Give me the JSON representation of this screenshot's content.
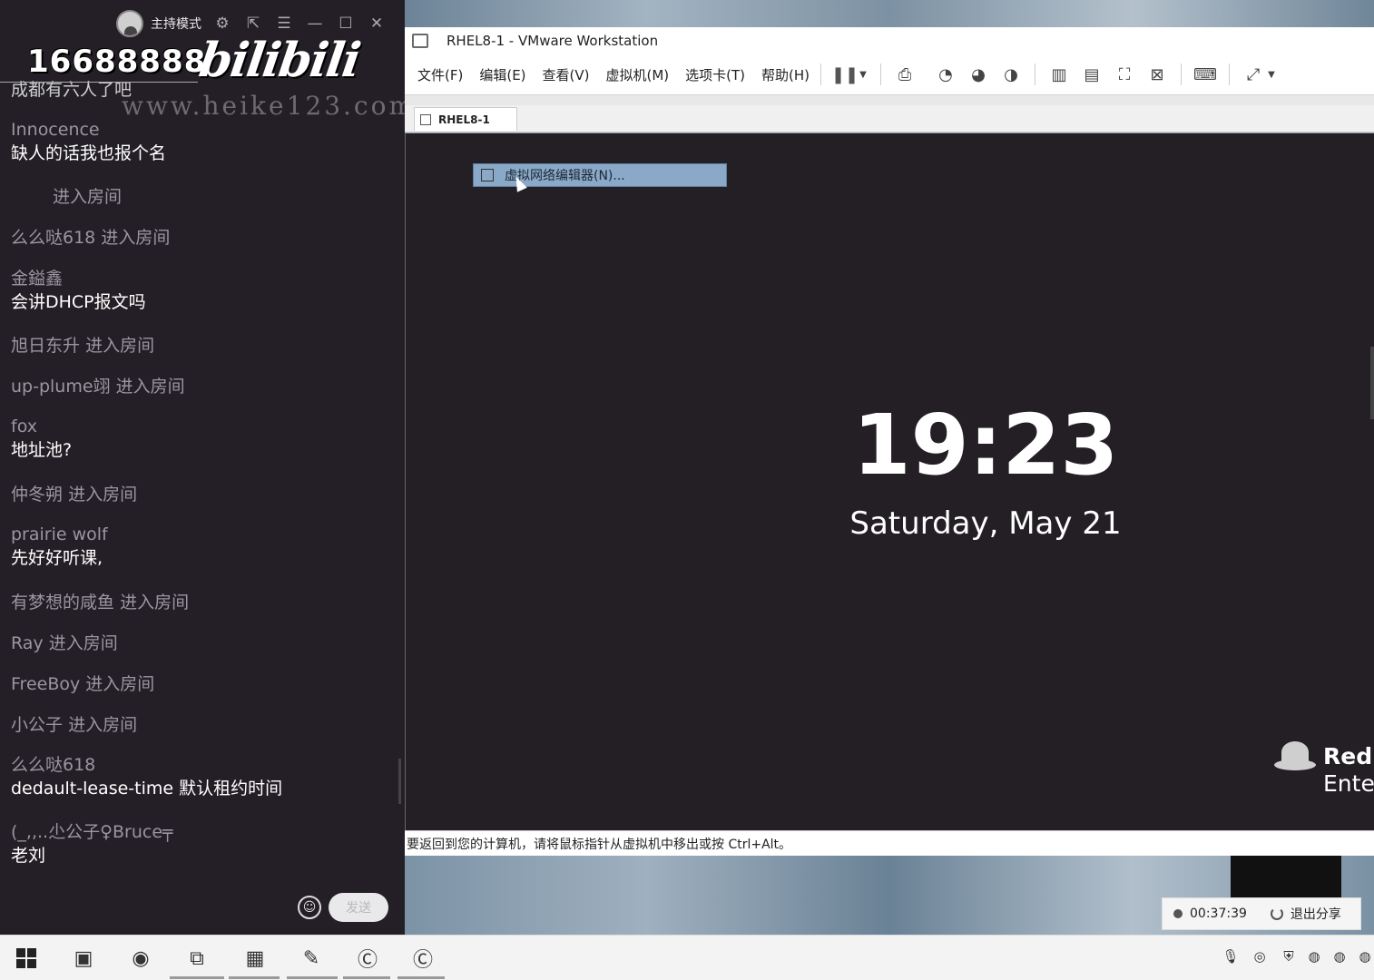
{
  "chat": {
    "host_mode_label": "主持模式",
    "watermark_number": "16688888",
    "watermark_brand": "bilibili",
    "watermark_url": "www.heike123.com",
    "top_message": "成都有六人了吧",
    "messages": [
      {
        "user": "Innocence",
        "text": "缺人的话我也报个名"
      },
      {
        "user": "",
        "action": "进入房间"
      },
      {
        "user": "么么哒618",
        "action": "进入房间"
      },
      {
        "user": "金鎰鑫",
        "text": "会讲DHCP报文吗"
      },
      {
        "user": "旭日东升",
        "action": "进入房间"
      },
      {
        "user": "up-plume翊",
        "action": "进入房间"
      },
      {
        "user": "fox",
        "text": "地址池?"
      },
      {
        "user": "仲冬朔",
        "action": "进入房间"
      },
      {
        "user": "prairie wolf",
        "text": "先好好听课,"
      },
      {
        "user": "有梦想的咸鱼",
        "action": "进入房间"
      },
      {
        "user": "Ray",
        "action": "进入房间"
      },
      {
        "user": "FreeBoy",
        "action": "进入房间"
      },
      {
        "user": "小公子",
        "action": "进入房间"
      },
      {
        "user": "么么哒618",
        "text": "dedault-lease-time 默认租约时间"
      },
      {
        "user": "(_,,..尐公子♀Bruce╤",
        "text": "老刘"
      }
    ],
    "send_label": "发送"
  },
  "vmware": {
    "title": "RHEL8-1 - VMware Workstation",
    "menu": [
      "文件(F)",
      "编辑(E)",
      "查看(V)",
      "虚拟机(M)",
      "选项卡(T)",
      "帮助(H)"
    ],
    "tab_label": "RHEL8-1",
    "tooltip": "虚拟网络编辑器(N)...",
    "clock_time": "19:23",
    "clock_date": "Saturday, May 21",
    "brand_line1": "Red",
    "brand_line2": "Ente",
    "status_text": "要返回到您的计算机，请将鼠标指针从虚拟机中移出或按 Ctrl+Alt。",
    "share_timer": "00:37:39",
    "exit_share": "退出分享"
  },
  "taskbar": {
    "apps": [
      "file-explorer-icon",
      "chrome-icon",
      "vmware-icon",
      "media-icon",
      "feather-icon",
      "c-app-icon",
      "c-app-icon"
    ],
    "tray": [
      "mic-icon",
      "network-icon",
      "shield-icon",
      "qq-icon",
      "qq-icon",
      "qq-icon",
      "qq-icon"
    ]
  }
}
